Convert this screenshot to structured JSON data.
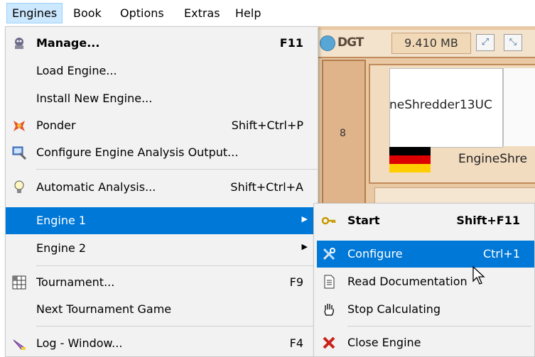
{
  "menubar": {
    "items": [
      {
        "label": "Engines",
        "active": true
      },
      {
        "label": "Book"
      },
      {
        "label": "Options"
      },
      {
        "label": "Extras"
      },
      {
        "label": "Help"
      }
    ]
  },
  "toolbar": {
    "memory": "9.410 MB"
  },
  "engine_panel": {
    "engine_name_partial": "neShredder13UC",
    "engine_name_right": "EngineShre",
    "board_rank_label": "8"
  },
  "engines_menu": {
    "manage": {
      "label": "Manage...",
      "shortcut": "F11",
      "icon": "manage-icon"
    },
    "load_engine": {
      "label": "Load Engine..."
    },
    "install_engine": {
      "label": "Install New Engine..."
    },
    "ponder": {
      "label": "Ponder",
      "shortcut": "Shift+Ctrl+P",
      "icon": "ponder-icon"
    },
    "configure_output": {
      "label": "Configure Engine Analysis Output...",
      "icon": "configure-output-icon"
    },
    "automatic_analysis": {
      "label": "Automatic Analysis...",
      "shortcut": "Shift+Ctrl+A",
      "icon": "lightbulb-icon"
    },
    "engine1": {
      "label": "Engine 1"
    },
    "engine2": {
      "label": "Engine 2"
    },
    "tournament": {
      "label": "Tournament...",
      "shortcut": "F9",
      "icon": "tournament-icon"
    },
    "next_tournament": {
      "label": "Next Tournament Game"
    },
    "log_window": {
      "label": "Log - Window...",
      "shortcut": "F4",
      "icon": "log-icon"
    }
  },
  "engine1_submenu": {
    "start": {
      "label": "Start",
      "shortcut": "Shift+F11",
      "icon": "key-icon"
    },
    "configure": {
      "label": "Configure",
      "shortcut": "Ctrl+1",
      "icon": "tools-icon"
    },
    "read_doc": {
      "label": "Read Documentation",
      "icon": "document-icon"
    },
    "stop": {
      "label": "Stop Calculating",
      "icon": "hand-icon"
    },
    "close": {
      "label": "Close Engine",
      "icon": "close-x-icon"
    }
  },
  "colors": {
    "highlight": "#0078d7",
    "menu_bg": "#f2f2f2",
    "board_bg": "#e9c9a3"
  }
}
